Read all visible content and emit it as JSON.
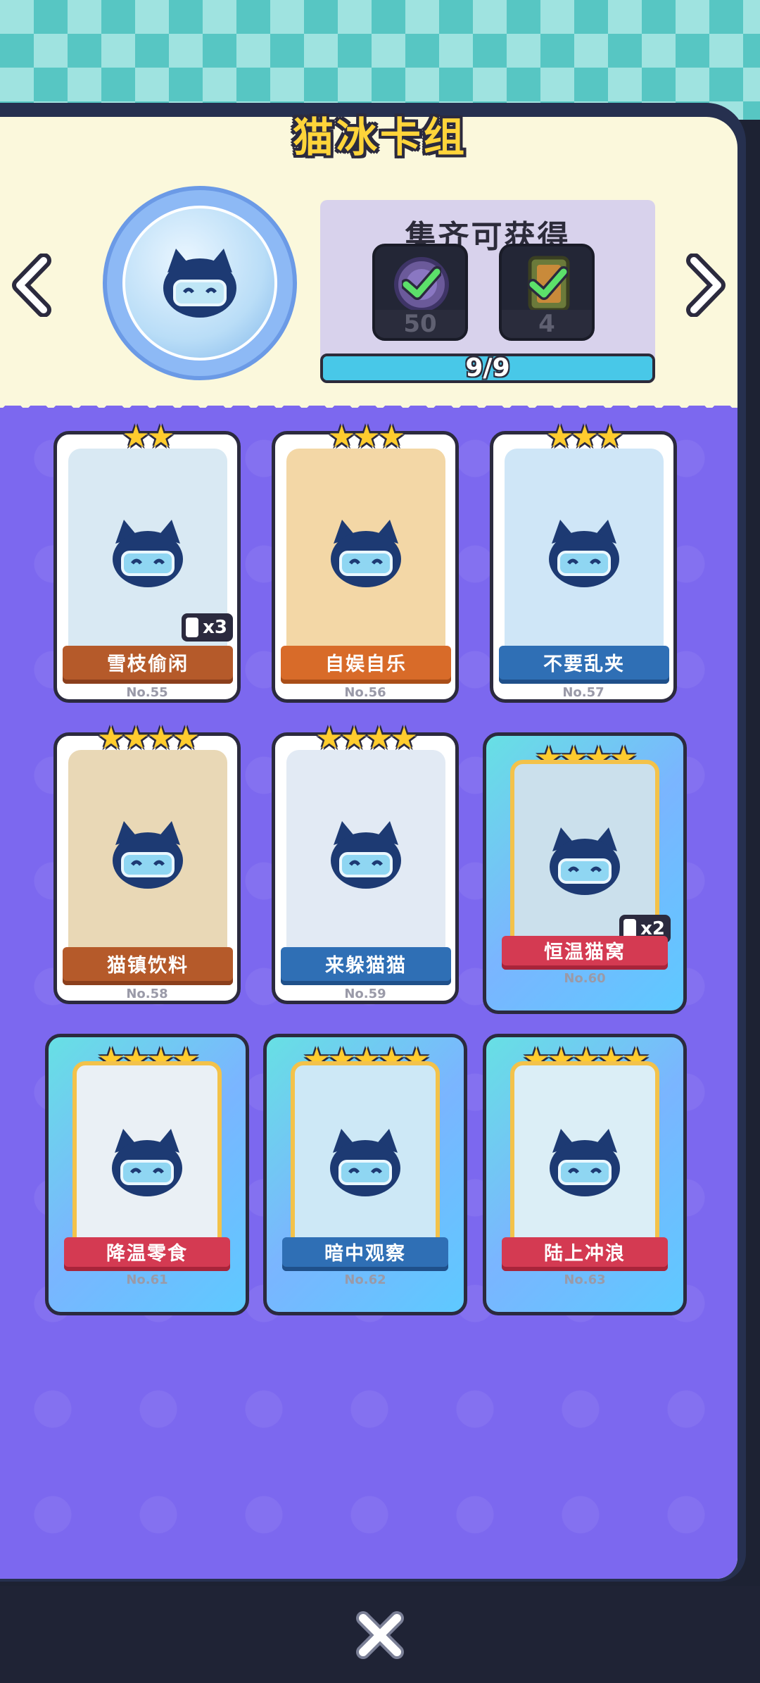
{
  "header": {
    "title": "猫冰卡组"
  },
  "reward": {
    "title": "集齐可获得",
    "items": [
      {
        "count": "50",
        "icon": "coin-icon"
      },
      {
        "count": "4",
        "icon": "card-pack-icon"
      }
    ],
    "progress_text": "9/9",
    "progress": 1.0
  },
  "cards": [
    {
      "name": "雪枝偷闲",
      "no": "No.55",
      "stars": "★★",
      "dup": "x3",
      "ribbon": "brown",
      "art": "#d9e9f3"
    },
    {
      "name": "自娱自乐",
      "no": "No.56",
      "stars": "★★★",
      "dup": "",
      "ribbon": "orange",
      "art": "#f3d7a6"
    },
    {
      "name": "不要乱夹",
      "no": "No.57",
      "stars": "★★★",
      "dup": "",
      "ribbon": "blue",
      "art": "#cfe6f7"
    },
    {
      "name": "猫镇饮料",
      "no": "No.58",
      "stars": "★★★★",
      "dup": "",
      "ribbon": "brown",
      "art": "#e9d8b6"
    },
    {
      "name": "来躲猫猫",
      "no": "No.59",
      "stars": "★★★★",
      "dup": "",
      "ribbon": "blue",
      "art": "#e2eaf4"
    },
    {
      "name": "恒温猫窝",
      "no": "No.60",
      "stars": "★★★★",
      "dup": "x2",
      "ribbon": "red",
      "art": "#cbe0ec"
    },
    {
      "name": "降温零食",
      "no": "No.61",
      "stars": "★★★★",
      "dup": "",
      "ribbon": "red",
      "art": "#eaf0f5"
    },
    {
      "name": "暗中观察",
      "no": "No.62",
      "stars": "★★★★★",
      "dup": "",
      "ribbon": "blue",
      "art": "#cde8f6"
    },
    {
      "name": "陆上冲浪",
      "no": "No.63",
      "stars": "★★★★★",
      "dup": "",
      "ribbon": "red",
      "art": "#dbeef6"
    }
  ]
}
